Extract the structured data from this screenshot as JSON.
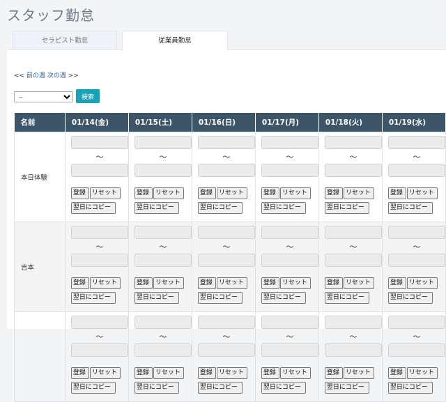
{
  "page": {
    "title": "スタッフ勤怠"
  },
  "tabs": [
    {
      "label": "セラピスト勤怠",
      "active": false
    },
    {
      "label": "従業員勤怠",
      "active": true
    }
  ],
  "week_nav": {
    "prev_prefix": "<<",
    "prev_label": "前の週",
    "next_label": "次の週",
    "next_suffix": ">>"
  },
  "filter": {
    "selected": "--"
  },
  "search_button": {
    "label": "検索"
  },
  "table": {
    "name_header": "名前",
    "days": [
      "01/14(金)",
      "01/15(土)",
      "01/16(日)",
      "01/17(月)",
      "01/18(火)",
      "01/19(水)"
    ],
    "tilde": "〜",
    "register_label": "登録",
    "reset_label": "リセット",
    "copy_label": "翌日にコピー",
    "rows": [
      {
        "name": "本日体験"
      },
      {
        "name": "吉本"
      },
      {
        "name": ""
      }
    ]
  },
  "colors": {
    "header_bg": "#3d5568",
    "accent": "#17a2b8",
    "link": "#2a5db0"
  }
}
